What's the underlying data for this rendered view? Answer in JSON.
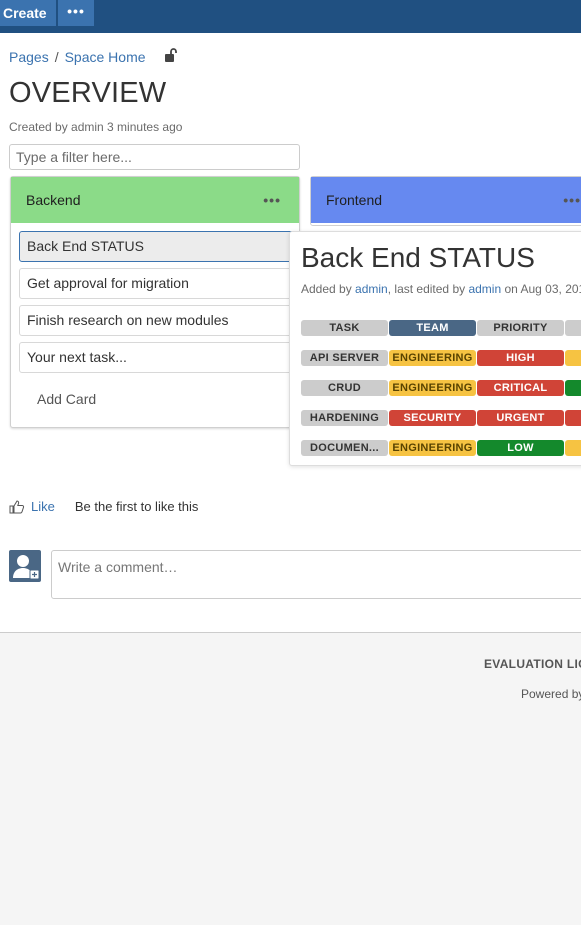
{
  "topbar": {
    "create_label": "Create",
    "more_label": "•••"
  },
  "breadcrumb": {
    "items": [
      "Pages",
      "Space Home"
    ]
  },
  "page": {
    "title": "OVERVIEW",
    "byline": "Created by admin 3 minutes ago",
    "filter_placeholder": "Type a filter here..."
  },
  "board": {
    "columns": [
      {
        "name": "Backend",
        "color": "#8bdb88",
        "cards": [
          "Back End STATUS",
          "Get approval for migration",
          "Finish research on new modules",
          "Your next task..."
        ],
        "add_card_label": "Add Card",
        "menu_label": "•••"
      },
      {
        "name": "Frontend",
        "color": "#6689f0",
        "menu_label": "•••"
      }
    ]
  },
  "popup": {
    "title": "Back End STATUS",
    "meta_added_by": "Added by ",
    "meta_added_user": "admin",
    "meta_last_edited": ", last edited by ",
    "meta_edited_user": "admin",
    "meta_date": " on Aug 03, 201",
    "rows": [
      [
        {
          "text": "TASK",
          "color": "grey"
        },
        {
          "text": "TEAM",
          "color": "blue"
        },
        {
          "text": "PRIORITY",
          "color": "grey"
        },
        {
          "text": "",
          "color": "grey"
        }
      ],
      [
        {
          "text": "API SERVER",
          "color": "grey"
        },
        {
          "text": "ENGINEERING",
          "color": "yellow"
        },
        {
          "text": "HIGH",
          "color": "red"
        },
        {
          "text": "",
          "color": "yellow"
        }
      ],
      [
        {
          "text": "CRUD",
          "color": "grey"
        },
        {
          "text": "ENGINEERING",
          "color": "yellow"
        },
        {
          "text": "CRITICAL",
          "color": "red"
        },
        {
          "text": "",
          "color": "green"
        }
      ],
      [
        {
          "text": "HARDENING",
          "color": "grey"
        },
        {
          "text": "SECURITY",
          "color": "red"
        },
        {
          "text": "URGENT",
          "color": "red"
        },
        {
          "text": "",
          "color": "red"
        }
      ],
      [
        {
          "text": "DOCUMEN...",
          "color": "grey"
        },
        {
          "text": "ENGINEERING",
          "color": "yellow"
        },
        {
          "text": "LOW",
          "color": "green"
        },
        {
          "text": "",
          "color": "yellow"
        }
      ]
    ]
  },
  "like": {
    "link_label": "Like",
    "text": "Be the first to like this"
  },
  "comment": {
    "placeholder": "Write a comment…"
  },
  "footer": {
    "license": "EVALUATION LIC",
    "powered": "Powered by"
  }
}
